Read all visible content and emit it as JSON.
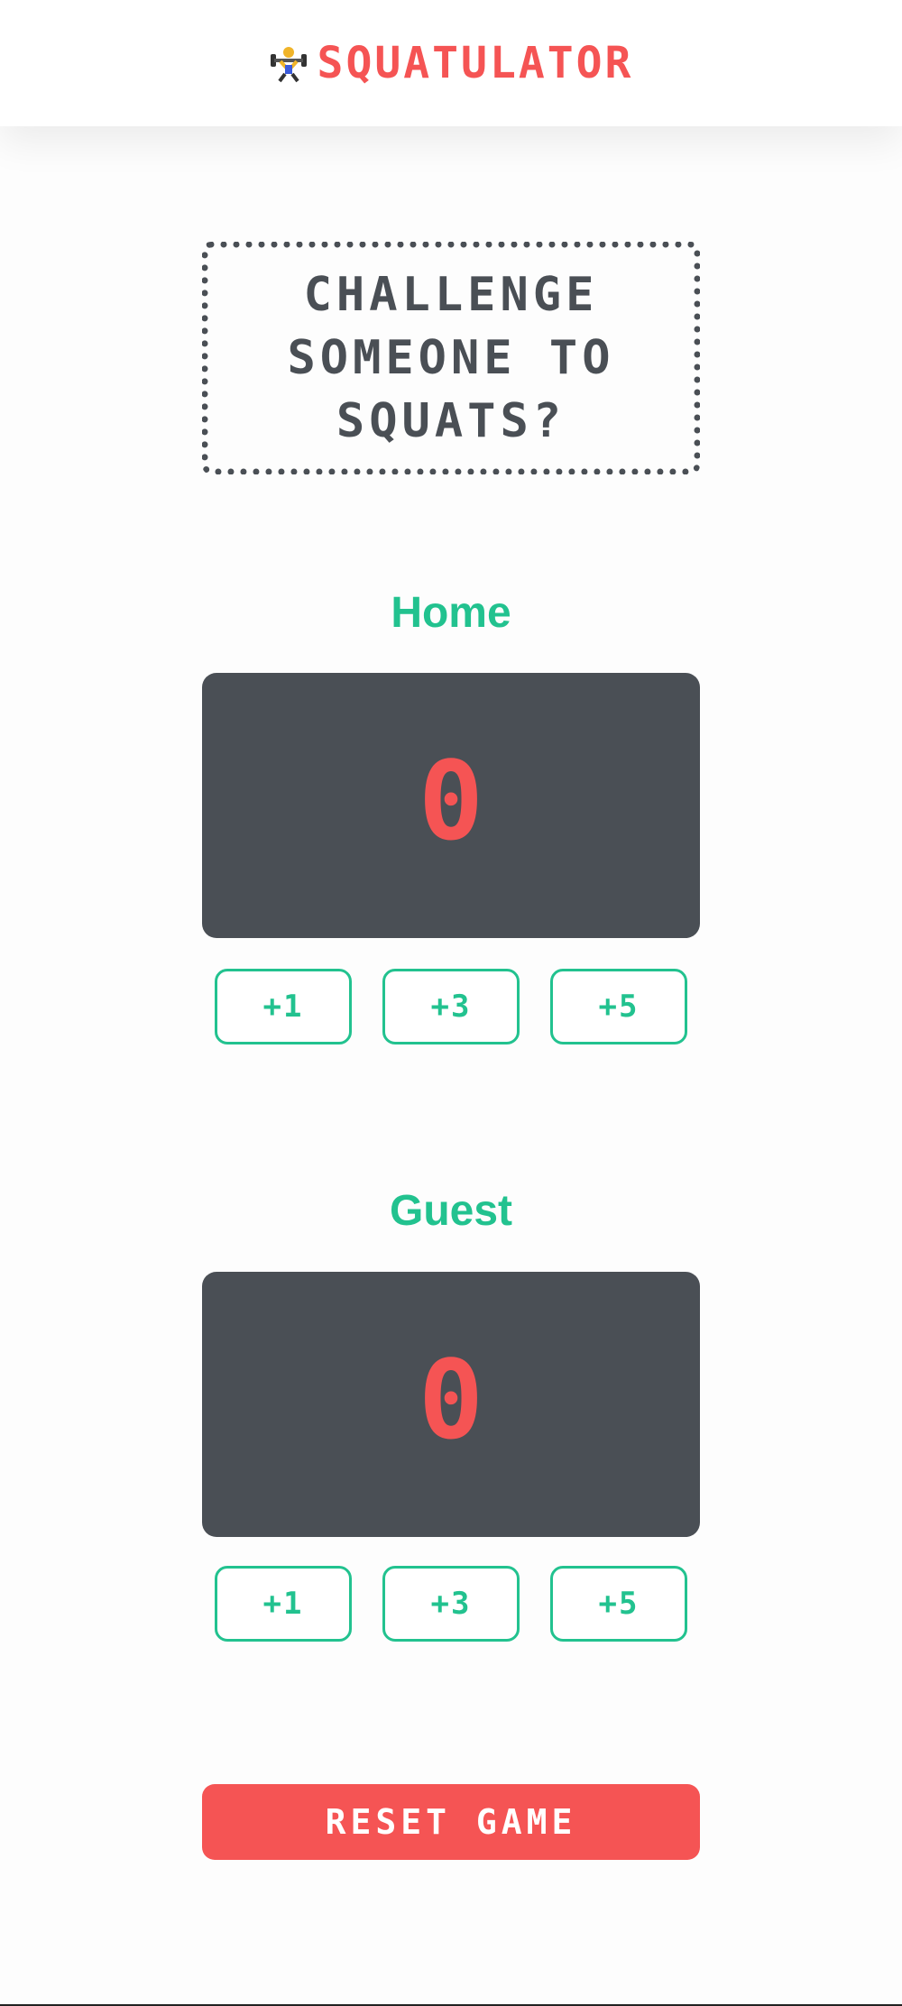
{
  "header": {
    "icon": "weightlifter-icon",
    "title": "SQUATULATOR"
  },
  "challenge": {
    "text": "CHALLENGE SOMEONE TO SQUATS?"
  },
  "home": {
    "title": "Home",
    "score": "0",
    "buttons": [
      "+1",
      "+3",
      "+5"
    ]
  },
  "guest": {
    "title": "Guest",
    "score": "0",
    "buttons": [
      "+1",
      "+3",
      "+5"
    ]
  },
  "reset": {
    "label": "RESET GAME"
  },
  "colors": {
    "accent_red": "#f55454",
    "accent_green": "#22c28f",
    "board_gray": "#4a4f55"
  }
}
